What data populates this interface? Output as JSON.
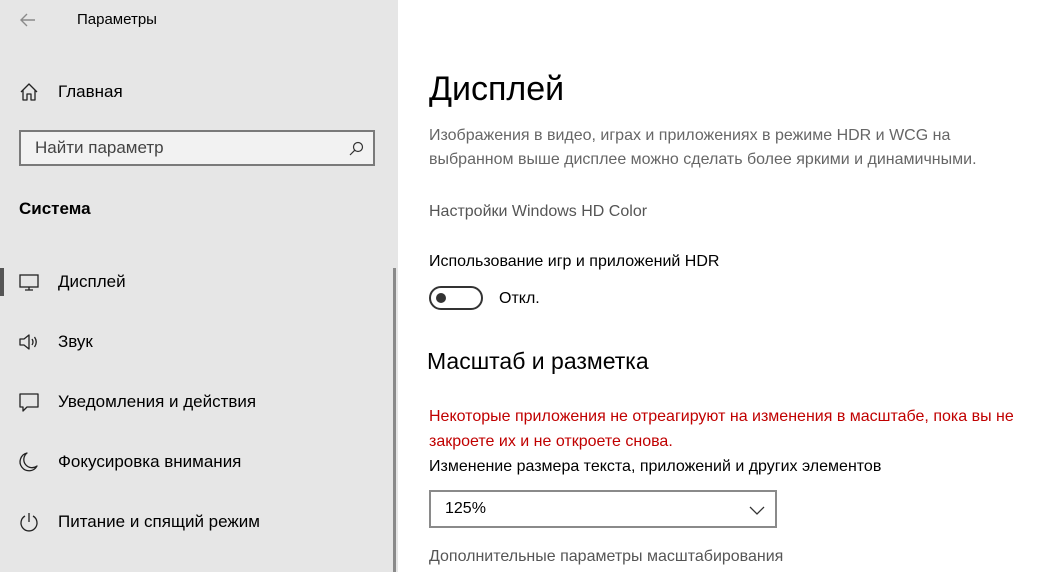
{
  "window": {
    "title": "Параметры"
  },
  "sidebar": {
    "home_label": "Главная",
    "search": {
      "placeholder": "Найти параметр",
      "value": ""
    },
    "section_heading": "Система",
    "items": [
      {
        "label": "Дисплей",
        "icon": "monitor-icon",
        "selected": true
      },
      {
        "label": "Звук",
        "icon": "speaker-icon",
        "selected": false
      },
      {
        "label": "Уведомления и действия",
        "icon": "notification-icon",
        "selected": false
      },
      {
        "label": "Фокусировка внимания",
        "icon": "moon-icon",
        "selected": false
      },
      {
        "label": "Питание и спящий режим",
        "icon": "power-icon",
        "selected": false
      }
    ]
  },
  "main": {
    "title": "Дисплей",
    "description": "Изображения в видео, играх и приложениях в режиме HDR и WCG на выбранном выше дисплее можно сделать более яркими и динамичными.",
    "hd_color_link": "Настройки Windows HD Color",
    "hdr_label": "Использование игр и приложений HDR",
    "hdr_toggle": {
      "on": false,
      "state_label": "Откл."
    },
    "scale_section_title": "Масштаб и разметка",
    "warning": "Некоторые приложения не отреагируют на изменения в масштабе, пока вы не закроете их и не откроете снова.",
    "scale_label": "Изменение размера текста, приложений и других элементов",
    "scale_value": "125%",
    "advanced_scaling_link": "Дополнительные параметры масштабирования"
  },
  "colors": {
    "sidebar_bg": "#e6e6e6",
    "warning": "#c00000",
    "secondary_text": "#666666"
  }
}
